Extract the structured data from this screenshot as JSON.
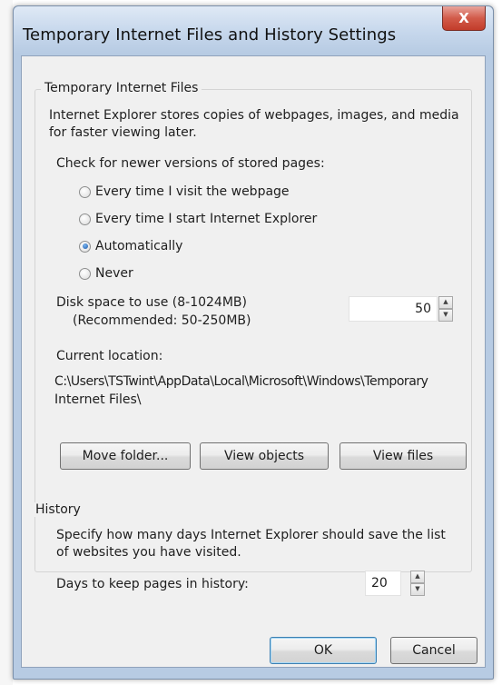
{
  "window": {
    "title": "Temporary Internet Files and History Settings",
    "close_label": "X"
  },
  "temp_files": {
    "group_label": "Temporary Internet Files",
    "description_line1": "Internet Explorer stores copies of webpages, images, and media",
    "description_line2": "for faster viewing later.",
    "check_label": "Check for newer versions of stored pages:",
    "options": [
      {
        "label": "Every time I visit the webpage",
        "checked": false
      },
      {
        "label": "Every time I start Internet Explorer",
        "checked": false
      },
      {
        "label": "Automatically",
        "checked": true
      },
      {
        "label": "Never",
        "checked": false
      }
    ],
    "disk_label_line1": "Disk space to use (8-1024MB)",
    "disk_label_line2": "(Recommended: 50-250MB)",
    "disk_value": "50",
    "current_location_label": "Current location:",
    "path_line1": "C:\\Users\\TSTwint\\AppData\\Local\\Microsoft\\Windows\\Temporary",
    "path_line2": "Internet Files\\",
    "buttons": {
      "move_folder": "Move folder...",
      "view_objects": "View objects",
      "view_files": "View files"
    }
  },
  "history": {
    "group_label": "History",
    "description_line1": "Specify how many days Internet Explorer should save the list",
    "description_line2": "of websites you have visited.",
    "days_label": "Days to keep pages in history:",
    "days_value": "20"
  },
  "footer": {
    "ok": "OK",
    "cancel": "Cancel"
  }
}
